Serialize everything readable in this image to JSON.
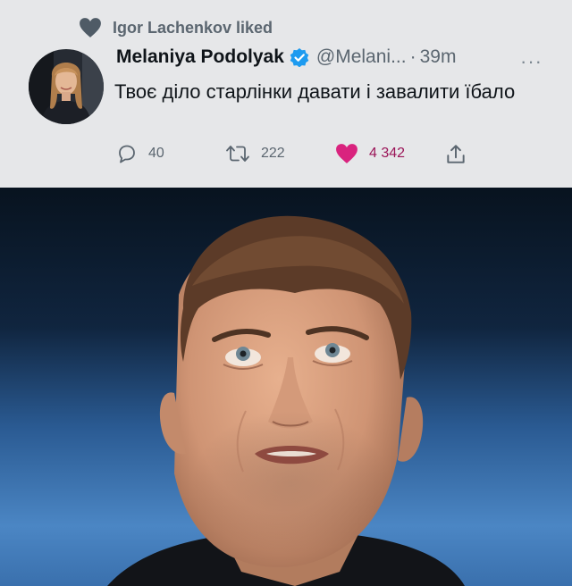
{
  "liked_by": "Igor Lachenkov liked",
  "tweet": {
    "author_name": "Melaniya Podolyak",
    "handle": "@Melani...",
    "separator": "·",
    "time": "39m",
    "more": "···",
    "text": "Твоє діло старлінки давати і завалити їбало"
  },
  "actions": {
    "replies": "40",
    "retweets": "222",
    "likes": "4 342"
  },
  "colors": {
    "card_bg": "#e6e7e9",
    "like_pink": "#d9237e",
    "verified_blue": "#1d9bf0",
    "muted_text": "#5b6670"
  },
  "icons": [
    "heart-icon",
    "verified-badge-icon",
    "more-icon",
    "reply-icon",
    "retweet-icon",
    "like-icon",
    "share-icon"
  ]
}
